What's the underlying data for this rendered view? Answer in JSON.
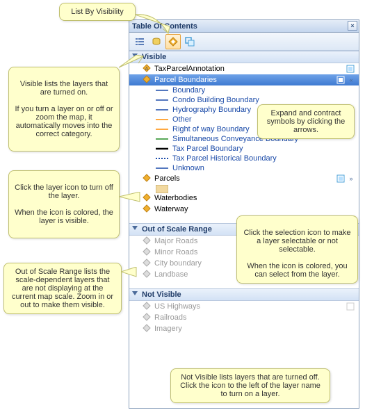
{
  "window": {
    "title": "Table Of Contents",
    "close_symbol": "×"
  },
  "toolbar": {
    "btn_list_drawing_order": "list-by-drawing-order",
    "btn_list_source": "list-by-source",
    "btn_list_visibility": "list-by-visibility",
    "btn_list_selection": "list-by-selection"
  },
  "groups": {
    "visible": {
      "label": "Visible"
    },
    "out_of_scale": {
      "label": "Out of Scale Range"
    },
    "not_visible": {
      "label": "Not Visible"
    }
  },
  "layers": {
    "visible": [
      {
        "name": "TaxParcelAnnotation",
        "type": "anno",
        "selectable": true
      },
      {
        "name": "Parcel Boundaries",
        "type": "line",
        "selected": true,
        "selectable": true,
        "expanded": true
      },
      {
        "name": "Parcels",
        "type": "poly",
        "selectable": true,
        "expandable": true,
        "swatch_color": "#f2d9a0"
      },
      {
        "name": "Waterbodies",
        "type": "poly",
        "selectable": false
      },
      {
        "name": "Waterway",
        "type": "line",
        "selectable": false
      }
    ],
    "parcel_boundaries_children": [
      {
        "name": "Boundary",
        "color": "#1a4aa8",
        "style": "solid"
      },
      {
        "name": "Condo Building Boundary",
        "color": "#1a4aa8",
        "style": "solid"
      },
      {
        "name": "Hydrography Boundary",
        "color": "#1a4aa8",
        "style": "solid"
      },
      {
        "name": "Other",
        "color": "#ff8c00",
        "style": "solid"
      },
      {
        "name": "Right of way Boundary",
        "color": "#ff8c00",
        "style": "solid"
      },
      {
        "name": "Simultaneous Conveyance Boundary",
        "color": "#228b22",
        "style": "solid"
      },
      {
        "name": "Tax Parcel Boundary",
        "color": "#000000",
        "style": "solid_thick"
      },
      {
        "name": "Tax Parcel Historical Boundary",
        "color": "#1a4aa8",
        "style": "dotted"
      },
      {
        "name": "Unknown",
        "color": "#1a4aa8",
        "style": "solid"
      }
    ],
    "out_of_scale": [
      {
        "name": "Major Roads"
      },
      {
        "name": "Minor Roads"
      },
      {
        "name": "City boundary"
      },
      {
        "name": "Landbase"
      }
    ],
    "not_visible": [
      {
        "name": "US Highways"
      },
      {
        "name": "Railroads"
      },
      {
        "name": "Imagery"
      }
    ]
  },
  "callouts": {
    "list_by_visibility": "List By Visibility",
    "visible_desc": "Visible lists the layers that are turned on.\n\nIf you turn a layer on or off or zoom the map, it automatically moves into the correct category.",
    "expand_desc": "Expand and contract symbols by clicking the arrows.",
    "layer_icon_desc": "Click the layer icon to turn off the layer.\n\nWhen the icon is colored, the layer is visible.",
    "selection_desc": "Click the selection icon to make a layer selectable or not selectable.\n\nWhen the icon is colored, you can select from the layer.",
    "oos_desc": "Out of Scale Range lists the scale-dependent layers that are not displaying at the current map scale. Zoom in or out to make them visible.",
    "not_visible_desc": "Not Visible lists layers that are turned off. Click the icon to the left of the layer name to turn on a layer."
  }
}
